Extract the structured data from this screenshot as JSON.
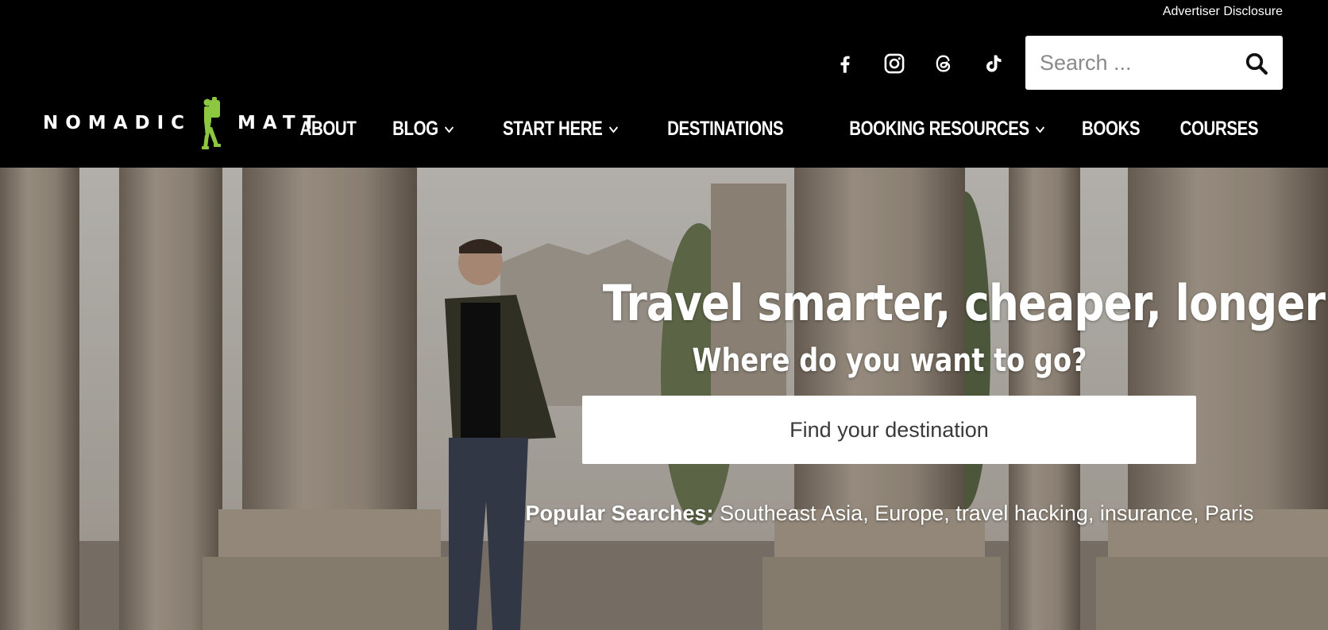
{
  "header": {
    "advertiser_disclosure": "Advertiser Disclosure",
    "logo": {
      "word_left": "NOMADIC",
      "word_right": "MATT",
      "figure_color": "#8dc63f"
    },
    "social": [
      {
        "name": "facebook",
        "icon": "facebook-icon"
      },
      {
        "name": "instagram",
        "icon": "instagram-icon"
      },
      {
        "name": "threads",
        "icon": "threads-icon"
      },
      {
        "name": "tiktok",
        "icon": "tiktok-icon"
      }
    ],
    "search": {
      "placeholder": "Search ...",
      "icon": "search-icon"
    },
    "nav": [
      {
        "label": "ABOUT",
        "has_dropdown": false
      },
      {
        "label": "BLOG",
        "has_dropdown": true
      },
      {
        "label": "START HERE",
        "has_dropdown": true
      },
      {
        "label": "DESTINATIONS",
        "has_dropdown": false
      },
      {
        "label": "BOOKING RESOURCES",
        "has_dropdown": true
      },
      {
        "label": "BOOKS",
        "has_dropdown": false
      },
      {
        "label": "COURSES",
        "has_dropdown": false
      }
    ]
  },
  "hero": {
    "title": "Travel smarter, cheaper, longer",
    "subtitle": "Where do you want to go?",
    "destination_placeholder": "Find your destination",
    "popular_label": "Popular Searches:",
    "popular_links": [
      "Southeast Asia",
      "Europe",
      "travel hacking",
      "insurance",
      "Paris"
    ]
  },
  "colors": {
    "header_bg": "#000000",
    "brand_green": "#8dc63f",
    "text_white": "#ffffff"
  }
}
